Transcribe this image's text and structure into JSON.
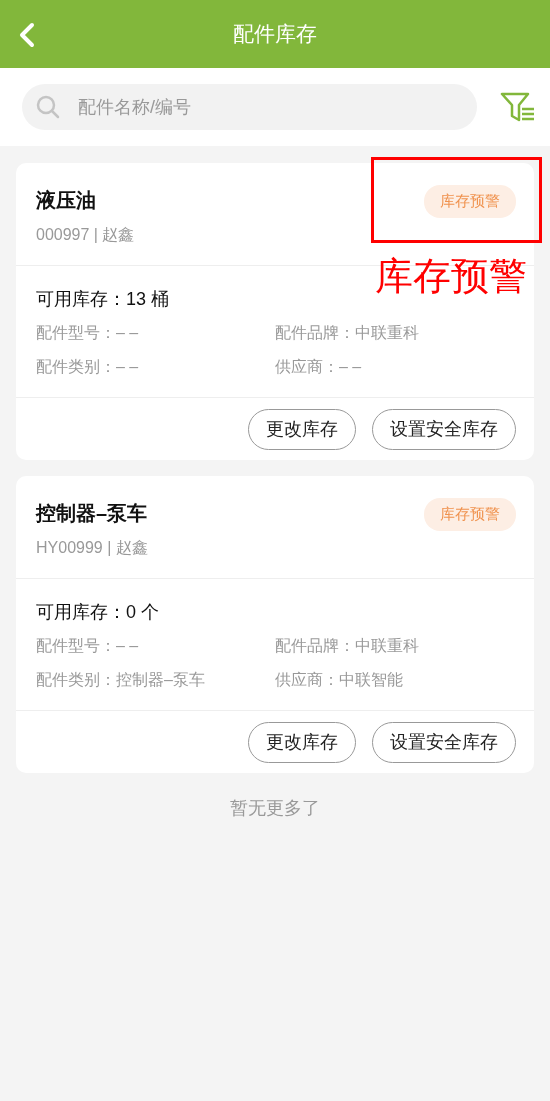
{
  "header": {
    "title": "配件库存"
  },
  "search": {
    "placeholder": "配件名称/编号"
  },
  "parts": [
    {
      "name": "液压油",
      "meta": "000997 | 赵鑫",
      "badge": "库存预警",
      "stock": "可用库存：13 桶",
      "fields": [
        "配件型号：– –",
        "配件品牌：中联重科",
        "配件类别：– –",
        "供应商：– –"
      ],
      "buttons": [
        "更改库存",
        "设置安全库存"
      ]
    },
    {
      "name": "控制器–泵车",
      "meta": "HY00999 | 赵鑫",
      "badge": "库存预警",
      "stock": "可用库存：0 个",
      "fields": [
        "配件型号：– –",
        "配件品牌：中联重科",
        "配件类别：控制器–泵车",
        "供应商：中联智能"
      ],
      "buttons": [
        "更改库存",
        "设置安全库存"
      ]
    }
  ],
  "footer": "暂无更多了",
  "annotation": {
    "label": "库存预警"
  }
}
